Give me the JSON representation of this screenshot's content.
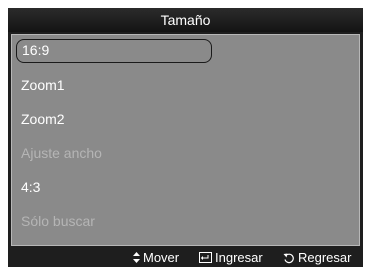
{
  "menu": {
    "title": "Tamaño",
    "items": [
      {
        "label": "16:9",
        "selected": true,
        "enabled": true
      },
      {
        "label": "Zoom1",
        "selected": false,
        "enabled": true
      },
      {
        "label": "Zoom2",
        "selected": false,
        "enabled": true
      },
      {
        "label": "Ajuste ancho",
        "selected": false,
        "enabled": false
      },
      {
        "label": "4:3",
        "selected": false,
        "enabled": true
      },
      {
        "label": "Sólo buscar",
        "selected": false,
        "enabled": false
      }
    ]
  },
  "footer": {
    "move": {
      "icon": "up-down-arrows-icon",
      "label": "Mover"
    },
    "enter": {
      "icon": "enter-icon",
      "label": "Ingresar"
    },
    "return": {
      "icon": "return-icon",
      "label": "Regresar"
    }
  },
  "colors": {
    "panel_bg": "#8a8a8a",
    "frame_bg": "#1e1e1e",
    "text": "#ffffff",
    "disabled_text": "#b5b5b5"
  }
}
